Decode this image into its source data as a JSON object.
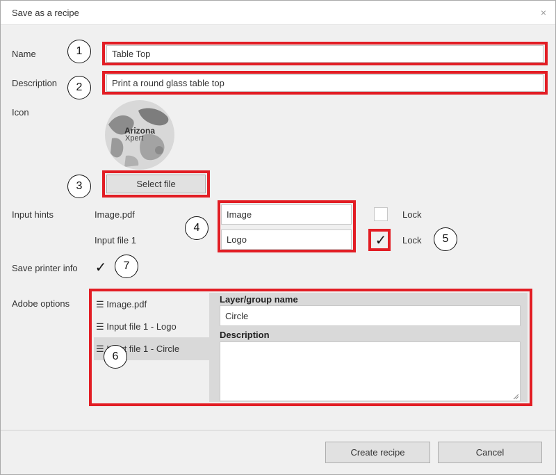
{
  "dialog": {
    "title": "Save as a recipe",
    "close_glyph": "×"
  },
  "form": {
    "name_label": "Name",
    "name_value": "Table Top",
    "description_label": "Description",
    "description_value": "Print a round glass table top",
    "icon_label": "Icon",
    "icon_logo_line1": "Arizona",
    "icon_logo_line2": "Xpert",
    "select_file_label": "Select file",
    "input_hints_label": "Input hints",
    "hints": [
      {
        "file": "Image.pdf",
        "hint": "Image",
        "lock_label": "Lock",
        "locked": false,
        "check_glyph": ""
      },
      {
        "file": "Input file 1",
        "hint": "Logo",
        "lock_label": "Lock",
        "locked": true,
        "check_glyph": "✓"
      }
    ],
    "save_printer_info_label": "Save printer info",
    "save_printer_info_checked": true,
    "save_printer_info_glyph": "✓",
    "adobe_options_label": "Adobe options",
    "adobe_list": [
      {
        "icon": "menu-icon",
        "label": "Image.pdf"
      },
      {
        "icon": "menu-icon",
        "label": "Input file 1 - Logo"
      },
      {
        "icon": "menu-icon",
        "label": "Input file 1 - Circle",
        "selected": true
      }
    ],
    "layer_group_name_label": "Layer/group name",
    "layer_group_name_value": "Circle",
    "layer_description_label": "Description",
    "layer_description_value": ""
  },
  "callouts": [
    "1",
    "2",
    "3",
    "4",
    "5",
    "6",
    "7"
  ],
  "footer": {
    "create_label": "Create recipe",
    "cancel_label": "Cancel"
  },
  "colors": {
    "highlight": "#e21d24",
    "dialog_bg": "#f0f0f0",
    "selected_bg": "#d9d9d9"
  }
}
